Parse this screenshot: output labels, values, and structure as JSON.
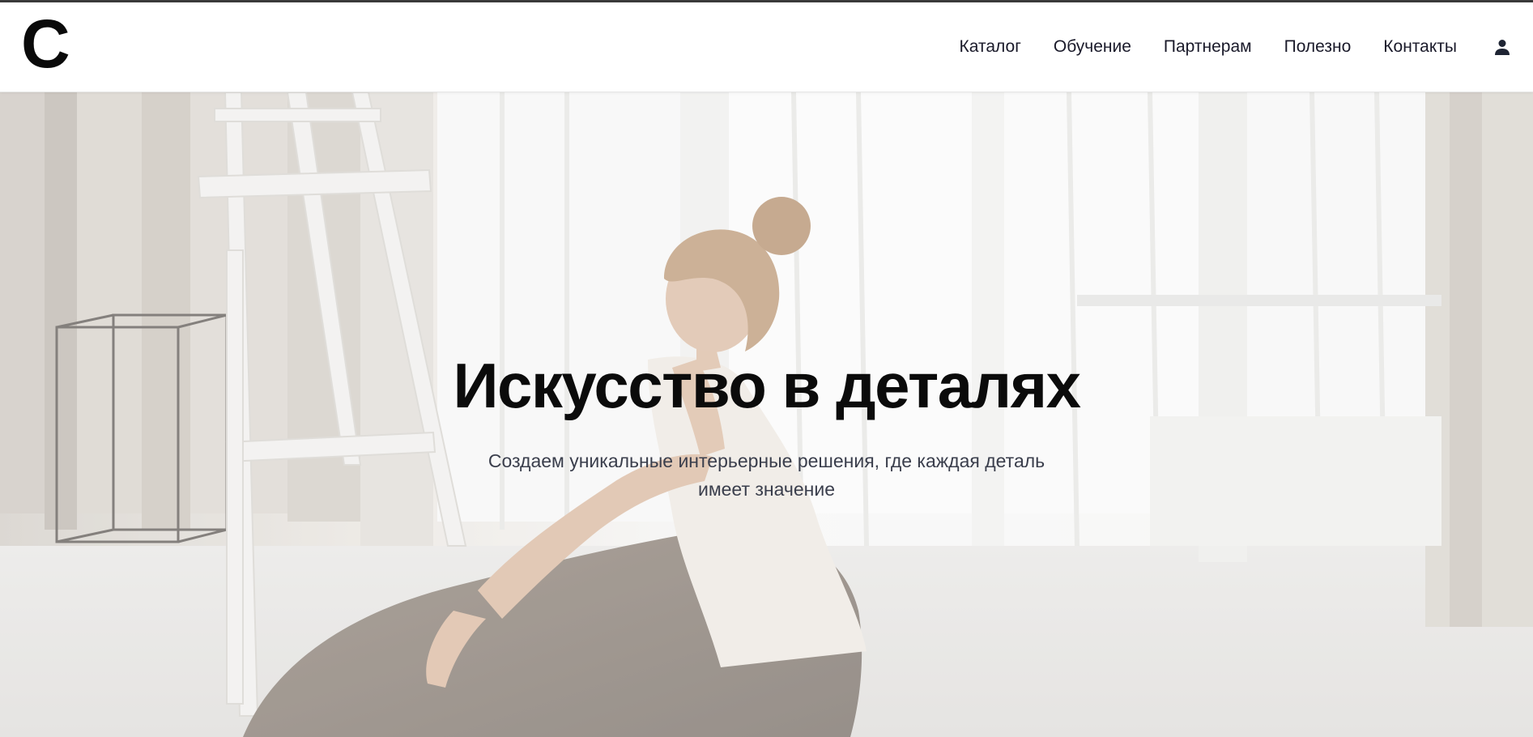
{
  "header": {
    "logo_text": "C",
    "nav": [
      {
        "label": "Каталог"
      },
      {
        "label": "Обучение"
      },
      {
        "label": "Партнерам"
      },
      {
        "label": "Полезно"
      },
      {
        "label": "Контакты"
      }
    ],
    "user_icon": "person-icon"
  },
  "hero": {
    "title": "Искусство в деталях",
    "subtitle": "Создаем уникальные интерьерные решения, где каждая деталь имеет значение",
    "background": "photo-woman-sitting-in-bright-studio-with-easel"
  },
  "colors": {
    "text_dark": "#0b0b0b",
    "nav_text": "#1a1a2a",
    "subtitle_text": "#3a3e4c",
    "header_bg": "#ffffff"
  }
}
